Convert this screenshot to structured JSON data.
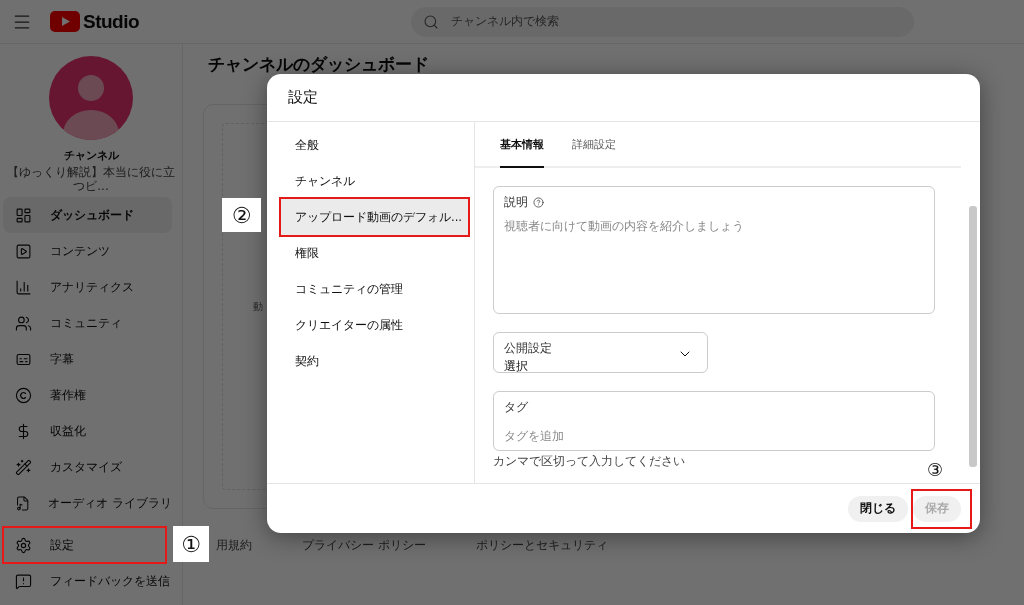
{
  "header": {
    "logo_text": "Studio",
    "search": {
      "placeholder": "チャンネル内で検索"
    }
  },
  "sidebar": {
    "channel_name": "チャンネル",
    "channel_subtitle": "【ゆっくり解説】本当に役に立つビ...",
    "items": [
      {
        "kind": "dashboard",
        "label": "ダッシュボード",
        "selected": true
      },
      {
        "kind": "content",
        "label": "コンテンツ",
        "selected": false
      },
      {
        "kind": "analytics",
        "label": "アナリティクス",
        "selected": false
      },
      {
        "kind": "community",
        "label": "コミュニティ",
        "selected": false
      },
      {
        "kind": "subtitles",
        "label": "字幕",
        "selected": false
      },
      {
        "kind": "copyright",
        "label": "著作権",
        "selected": false
      },
      {
        "kind": "earn",
        "label": "収益化",
        "selected": false
      },
      {
        "kind": "customize",
        "label": "カスタマイズ",
        "selected": false
      },
      {
        "kind": "audio",
        "label": "オーディオ ライブラリ",
        "selected": false
      }
    ],
    "bottom_items": [
      {
        "kind": "settings",
        "label": "設定",
        "selected": false,
        "callout": {
          "label": "①"
        }
      },
      {
        "kind": "feedback",
        "label": "フィードバックを送信",
        "selected": false
      }
    ]
  },
  "main": {
    "title": "チャンネルのダッシュボード",
    "card_text": "動",
    "footer_links": [
      "用規約",
      "プライバシー ポリシー",
      "ポリシーとセキュリティ"
    ]
  },
  "dialog": {
    "title": "設定",
    "nav": [
      {
        "label": "全般",
        "selected": false
      },
      {
        "label": "チャンネル",
        "selected": false
      },
      {
        "label": "アップロード動画のデフォル...",
        "selected": true,
        "callout": {
          "label": "②"
        }
      },
      {
        "label": "権限",
        "selected": false
      },
      {
        "label": "コミュニティの管理",
        "selected": false
      },
      {
        "label": "クリエイターの属性",
        "selected": false
      },
      {
        "label": "契約",
        "selected": false
      }
    ],
    "tabs": [
      {
        "label": "基本情報",
        "selected": true
      },
      {
        "label": "詳細設定",
        "selected": false
      }
    ],
    "description": {
      "label": "説明",
      "placeholder": "視聴者に向けて動画の内容を紹介しましょう"
    },
    "visibility": {
      "label": "公開設定",
      "value": "選択"
    },
    "tags": {
      "label": "タグ",
      "placeholder": "タグを追加",
      "hint": "カンマで区切って入力してください"
    },
    "buttons": [
      {
        "label": "閉じる",
        "disabled": false
      },
      {
        "label": "保存",
        "disabled": true,
        "callout": {
          "label": "③"
        }
      }
    ]
  }
}
